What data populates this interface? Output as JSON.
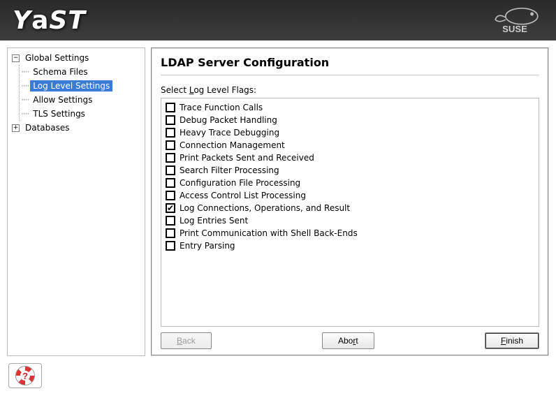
{
  "logo_text": "YaST",
  "brand": "SUSE",
  "sidebar": {
    "nodes": [
      {
        "label": "Global Settings",
        "expanded": true,
        "children": [
          {
            "label": "Schema Files",
            "selected": false
          },
          {
            "label": "Log Level Settings",
            "selected": true
          },
          {
            "label": "Allow Settings",
            "selected": false
          },
          {
            "label": "TLS Settings",
            "selected": false
          }
        ]
      },
      {
        "label": "Databases",
        "expanded": false,
        "children": []
      }
    ]
  },
  "panel": {
    "title": "LDAP Server Configuration",
    "section_prefix": "Select ",
    "section_hotkey": "L",
    "section_suffix": "og Level Flags:",
    "flags": [
      {
        "label": "Trace Function Calls",
        "checked": false
      },
      {
        "label": "Debug Packet Handling",
        "checked": false
      },
      {
        "label": "Heavy Trace Debugging",
        "checked": false
      },
      {
        "label": "Connection Management",
        "checked": false
      },
      {
        "label": "Print Packets Sent and Received",
        "checked": false
      },
      {
        "label": "Search Filter Processing",
        "checked": false
      },
      {
        "label": "Configuration File Processing",
        "checked": false
      },
      {
        "label": "Access Control List Processing",
        "checked": false
      },
      {
        "label": "Log Connections, Operations, and Result",
        "checked": true
      },
      {
        "label": "Log Entries Sent",
        "checked": false
      },
      {
        "label": "Print Communication with Shell Back-Ends",
        "checked": false
      },
      {
        "label": "Entry Parsing",
        "checked": false
      }
    ]
  },
  "buttons": {
    "back_pre": "",
    "back_hot": "B",
    "back_post": "ack",
    "abort_pre": "Abo",
    "abort_hot": "r",
    "abort_post": "t",
    "finish_pre": "",
    "finish_hot": "F",
    "finish_post": "inish"
  }
}
